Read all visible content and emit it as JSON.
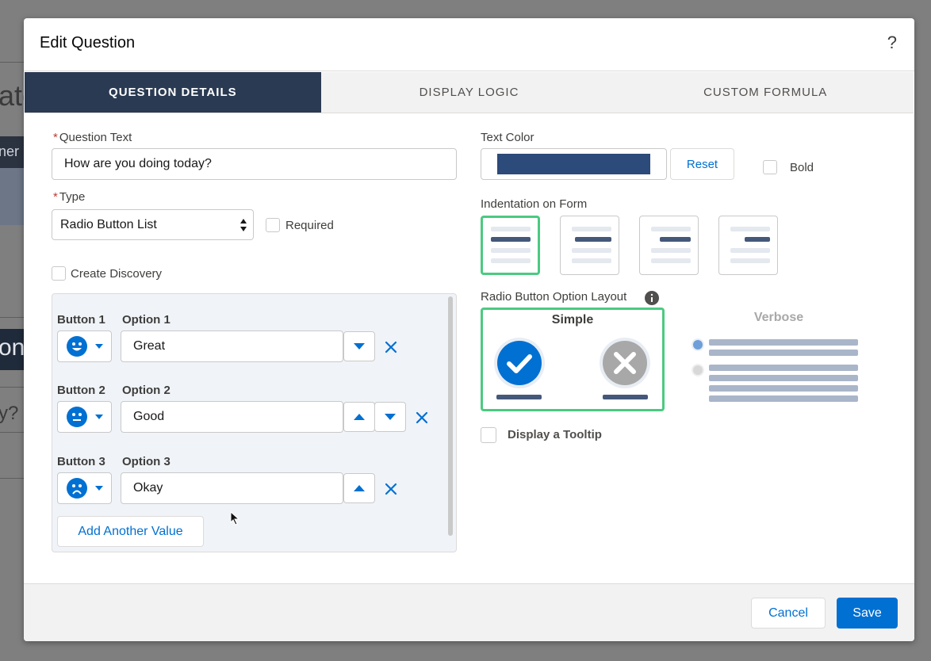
{
  "background": {
    "frag1": "ate",
    "frag2": "ner",
    "frag3": "on",
    "frag4": "y?"
  },
  "modal": {
    "title": "Edit Question",
    "help_label": "?"
  },
  "tabs": [
    {
      "label": "QUESTION DETAILS",
      "active": true
    },
    {
      "label": "DISPLAY LOGIC",
      "active": false
    },
    {
      "label": "CUSTOM FORMULA",
      "active": false
    }
  ],
  "left": {
    "question_text_label": "Question Text",
    "question_text_value": "How are you doing today?",
    "type_label": "Type",
    "type_value": "Radio Button List",
    "required_label": "Required",
    "required_checked": false,
    "create_discovery_label": "Create Discovery",
    "create_discovery_checked": false,
    "required_marker": "*"
  },
  "options": {
    "items": [
      {
        "button_label": "Button 1",
        "option_label": "Option 1",
        "value": "Great",
        "face": "happy-face-icon"
      },
      {
        "button_label": "Button 2",
        "option_label": "Option 2",
        "value": "Good",
        "face": "neutral-face-icon"
      },
      {
        "button_label": "Button 3",
        "option_label": "Option 3",
        "value": "Okay",
        "face": "sad-face-icon"
      }
    ],
    "add_label": "Add Another Value"
  },
  "right": {
    "text_color_label": "Text Color",
    "text_color_value": "#2c4a7a",
    "reset_label": "Reset",
    "bold_label": "Bold",
    "bold_checked": false,
    "indentation_label": "Indentation on Form",
    "indentation_selected": 0,
    "layout_label": "Radio Button Option Layout",
    "layout_simple_label": "Simple",
    "layout_verbose_label": "Verbose",
    "layout_selected": "Simple",
    "tooltip_label": "Display a Tooltip",
    "tooltip_checked": false
  },
  "footer": {
    "cancel_label": "Cancel",
    "save_label": "Save"
  },
  "colors": {
    "brand": "#0070d2",
    "active_tab": "#2a3a52",
    "selection_green": "#4bca81",
    "required_red": "#c23934"
  }
}
